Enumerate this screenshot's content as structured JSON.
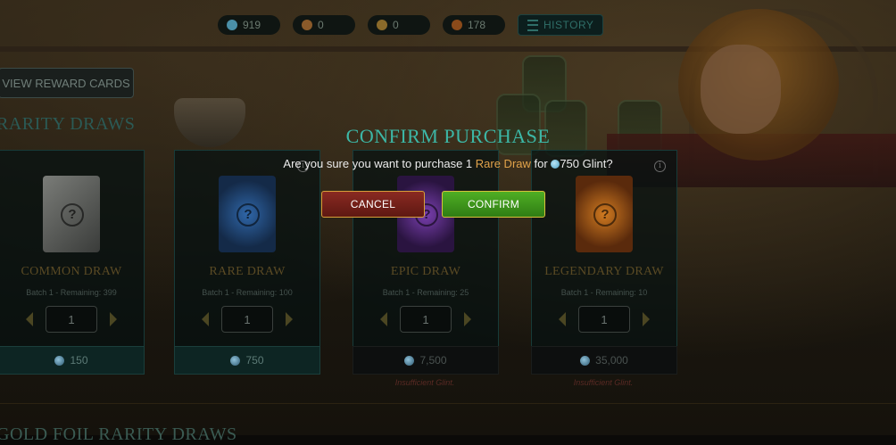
{
  "topbar": {
    "resources": [
      {
        "name": "glint",
        "value": "919",
        "color": "#4a8fa8"
      },
      {
        "name": "potion",
        "value": "0",
        "color": "#8a5a2a"
      },
      {
        "name": "bag",
        "value": "0",
        "color": "#8a6a2a"
      },
      {
        "name": "trophy",
        "value": "178",
        "color": "#8a4a1a"
      }
    ],
    "history_label": "HISTORY"
  },
  "view_reward_label": "VIEW REWARD CARDS",
  "section_title": "RARITY DRAWS",
  "gold_section_title": "GOLD FOIL RARITY DRAWS",
  "cards": [
    {
      "name": "COMMON DRAW",
      "batch": "Batch 1 - Remaining: 399",
      "qty": "1",
      "price": "150",
      "insufficient": "",
      "art_color": "#5d5f5c"
    },
    {
      "name": "RARE DRAW",
      "batch": "Batch 1 - Remaining: 100",
      "qty": "1",
      "price": "750",
      "insufficient": "",
      "art_color": "#274a72"
    },
    {
      "name": "EPIC DRAW",
      "batch": "Batch 1 - Remaining: 25",
      "qty": "1",
      "price": "7,500",
      "insufficient": "Insufficient Glint.",
      "art_color": "#4a2a6a"
    },
    {
      "name": "LEGENDARY DRAW",
      "batch": "Batch 1 - Remaining: 10",
      "qty": "1",
      "price": "35,000",
      "insufficient": "Insufficient Glint.",
      "art_color": "#8a4a16"
    }
  ],
  "modal": {
    "title": "CONFIRM PURCHASE",
    "msg_prefix": "Are you sure you want to purchase 1",
    "msg_item": "Rare Draw",
    "msg_for": "for",
    "msg_price": "750 Glint?",
    "cancel_label": "CANCEL",
    "confirm_label": "CONFIRM"
  }
}
